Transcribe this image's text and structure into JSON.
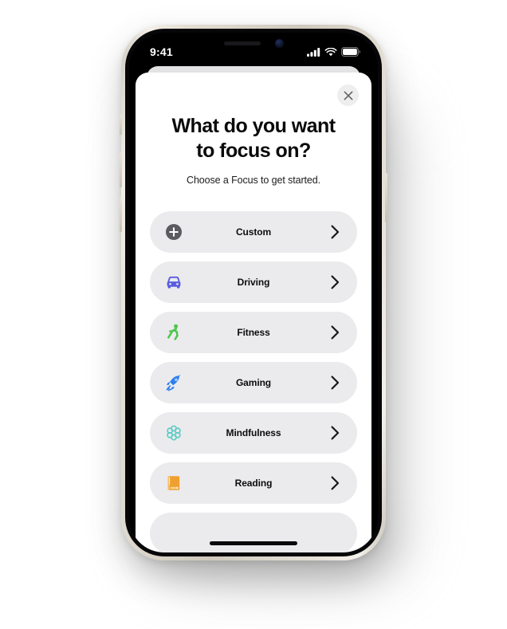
{
  "device": {
    "status_bar": {
      "time": "9:41",
      "cellular_icon": "cellular-bars-icon",
      "wifi_icon": "wifi-icon",
      "battery_icon": "battery-icon"
    },
    "home_indicator": "home-indicator"
  },
  "sheet": {
    "close_icon": "close-icon",
    "title": "What do you want to focus on?",
    "title_line_1": "What do you want",
    "title_line_2": "to focus on?",
    "subtitle": "Choose a Focus to get started.",
    "chevron_icon": "chevron-right-icon"
  },
  "focus_options": [
    {
      "label": "Custom",
      "icon": "plus-circle-icon",
      "color": "#5b5b5f"
    },
    {
      "label": "Driving",
      "icon": "car-icon",
      "color": "#5a5ce0"
    },
    {
      "label": "Fitness",
      "icon": "running-icon",
      "color": "#4cc64c"
    },
    {
      "label": "Gaming",
      "icon": "rocket-icon",
      "color": "#2d7ff0"
    },
    {
      "label": "Mindfulness",
      "icon": "flower-icon",
      "color": "#62ccc6"
    },
    {
      "label": "Reading",
      "icon": "book-icon",
      "color": "#f0a030"
    }
  ],
  "colors": {
    "sheet_background": "#ffffff",
    "row_background": "#ebebed",
    "page_background": "#ffffff",
    "text_primary": "#0a0a0a"
  }
}
